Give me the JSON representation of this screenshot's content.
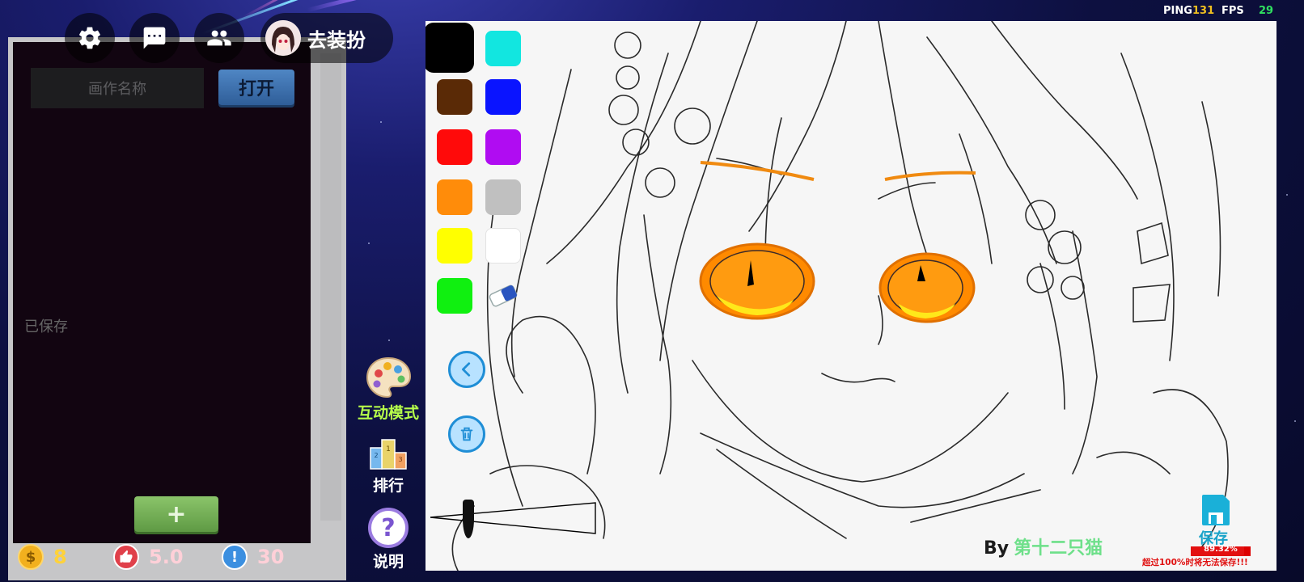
{
  "hud": {
    "ping_label": "PING",
    "ping_value": "131",
    "fps_label": "FPS",
    "fps_value": "29"
  },
  "top_buttons": {
    "settings_icon": "gear-icon",
    "chat_icon": "chat-bubble-icon",
    "friends_icon": "users-icon",
    "dress_label": "去装扮"
  },
  "gallery": {
    "name_placeholder": "画作名称",
    "open_label": "打开",
    "saved_label": "已保存",
    "add_label": "+"
  },
  "stats": {
    "coins": "8",
    "rating": "5.0",
    "reports": "30"
  },
  "side_menu": {
    "interactive_mode": "互动模式",
    "ranking": "排行",
    "help": "说明"
  },
  "palette": {
    "colors": [
      "#000000",
      "#12e6e0",
      "#5a2a06",
      "#0a14ff",
      "#ff0a0a",
      "#b00cf2",
      "#ff8c0a",
      "#c0c0c0",
      "#ffff00",
      "#ffffff",
      "#10f010"
    ],
    "selected": "#000000"
  },
  "tools": {
    "eraser_icon": "eraser-icon",
    "undo_icon": "undo-arrow-icon",
    "clear_icon": "trash-icon",
    "brush_size_icon": "brush-size-icon"
  },
  "credit": {
    "by": "By",
    "author": "第十二只猫"
  },
  "save": {
    "label": "保存",
    "progress_percent": 89.32,
    "progress_text": "89.32%",
    "warning": "超过100%时将无法保存!!!"
  },
  "colors": {
    "ping_color": "#f0c020",
    "fps_color": "#30e060",
    "mode_label_color": "#b6ff4a"
  }
}
